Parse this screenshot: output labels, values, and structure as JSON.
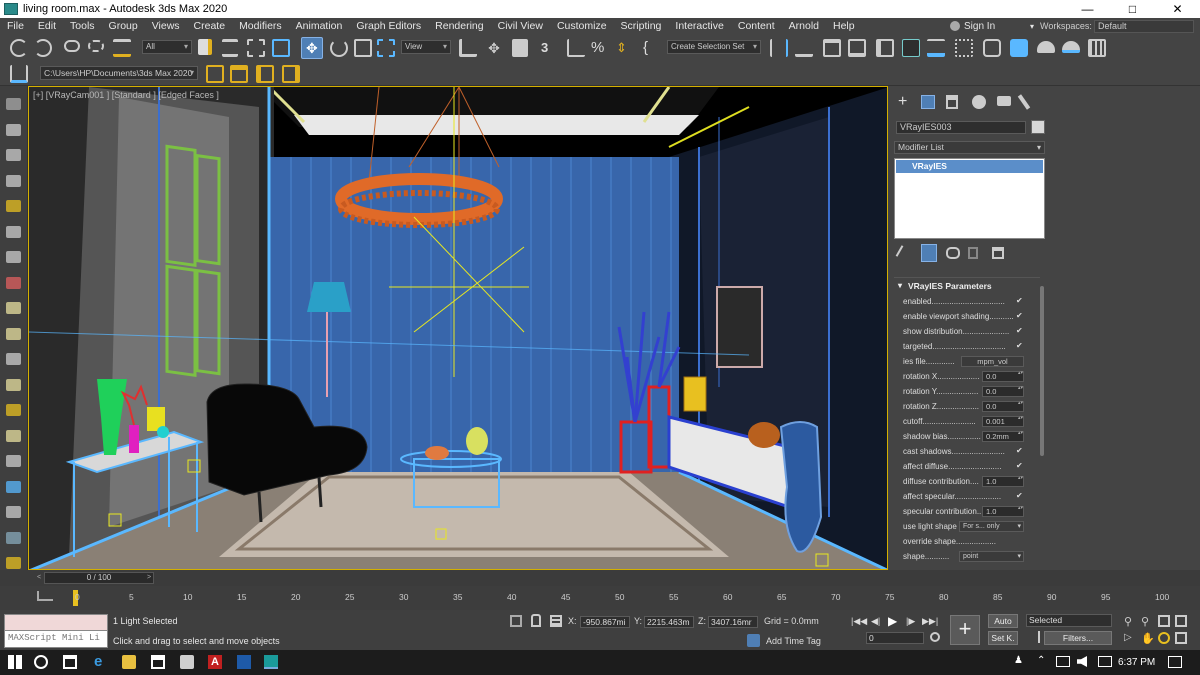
{
  "window": {
    "title": "living room.max - Autodesk 3ds Max 2020",
    "min_icon": "minimize-icon",
    "max_icon": "maximize-icon",
    "close_icon": "close-icon"
  },
  "menu": [
    "File",
    "Edit",
    "Tools",
    "Group",
    "Views",
    "Create",
    "Modifiers",
    "Animation",
    "Graph Editors",
    "Rendering",
    "Civil View",
    "Customize",
    "Scripting",
    "Interactive",
    "Content",
    "Arnold",
    "Help"
  ],
  "account": {
    "signin": "Sign In",
    "workspaces_label": "Workspaces:",
    "workspace": "Default"
  },
  "toolbar": {
    "selection_filter": "All",
    "ref_coord": "View",
    "named_selection": "Create Selection Set",
    "project_path": "C:\\Users\\HP\\Documents\\3ds Max 2020"
  },
  "viewport": {
    "label": "[+] [VRayCam001 ] [Standard ] [Edged Faces ]"
  },
  "command_panel": {
    "object_name": "VRayIES003",
    "object_color": "#d8d8d8",
    "modifier_list": "Modifier List",
    "stack_item": "VRayIES",
    "rollout_title": "VRayIES Parameters",
    "params": [
      {
        "label": "enabled",
        "dots": ".................................",
        "type": "check",
        "value": "✔"
      },
      {
        "label": "enable viewport shading",
        "dots": "...........",
        "type": "check",
        "value": "✔"
      },
      {
        "label": "show distribution",
        "dots": ".....................",
        "type": "check",
        "value": "✔"
      },
      {
        "label": "targeted",
        "dots": ".................................",
        "type": "check",
        "value": "✔"
      },
      {
        "label": "ies file",
        "dots": ".............",
        "type": "file",
        "value": "mpm_vol"
      },
      {
        "label": "rotation X",
        "dots": "...................",
        "type": "spin",
        "value": "0.0"
      },
      {
        "label": "rotation Y",
        "dots": "...................",
        "type": "spin",
        "value": "0.0"
      },
      {
        "label": "rotation Z",
        "dots": "...................",
        "type": "spin",
        "value": "0.0"
      },
      {
        "label": "cutoff",
        "dots": "........................",
        "type": "spin",
        "value": "0.001"
      },
      {
        "label": "shadow bias",
        "dots": "...............",
        "type": "spin",
        "value": "0.2mm"
      },
      {
        "label": "cast shadows",
        "dots": "........................",
        "type": "check",
        "value": "✔"
      },
      {
        "label": "affect diffuse",
        "dots": "........................",
        "type": "check",
        "value": "✔"
      },
      {
        "label": "diffuse contribution",
        "dots": "....",
        "type": "spin",
        "value": "1.0"
      },
      {
        "label": "affect specular",
        "dots": ".....................",
        "type": "check",
        "value": "✔"
      },
      {
        "label": "specular contribution",
        "dots": "..",
        "type": "spin",
        "value": "1.0"
      },
      {
        "label": "use light shape",
        "dots": "",
        "type": "select",
        "value": "For s... only"
      },
      {
        "label": "override shape",
        "dots": "..................",
        "type": "check",
        "value": ""
      },
      {
        "label": "shape",
        "dots": "...........",
        "type": "select",
        "value": "point"
      }
    ]
  },
  "timeline": {
    "frame_display": "0 / 100",
    "ticks": [
      "0",
      "5",
      "10",
      "15",
      "20",
      "25",
      "30",
      "35",
      "40",
      "45",
      "50",
      "55",
      "60",
      "65",
      "70",
      "75",
      "80",
      "85",
      "90",
      "95",
      "100"
    ]
  },
  "status": {
    "maxscript": "MAXScript Mini Li",
    "selection": "1 Light Selected",
    "prompt": "Click and drag to select and move objects",
    "x_label": "X:",
    "x": "-950.867mi",
    "y_label": "Y:",
    "y": "2215.463m",
    "z_label": "Z:",
    "z": "3407.16mr",
    "grid": "Grid = 0.0mm",
    "add_time_tag": "Add Time Tag",
    "auto_key": "Auto",
    "set_key": "Set K.",
    "key_filter_select": "Selected",
    "filters": "Filters...",
    "current_frame": "0"
  },
  "taskbar": {
    "time": "6:37 PM"
  }
}
